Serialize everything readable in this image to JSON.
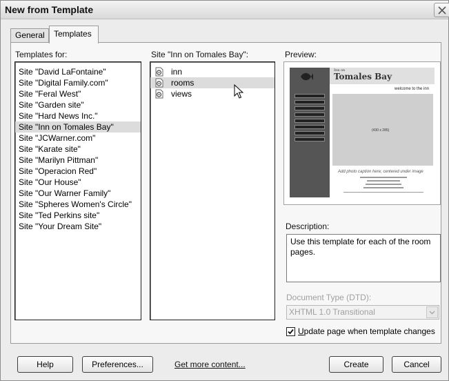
{
  "window": {
    "title": "New from Template"
  },
  "tabs": [
    {
      "label": "General"
    },
    {
      "label": "Templates"
    }
  ],
  "columns": {
    "templates_for_label": "Templates for:",
    "site_label": "Site \"Inn on Tomales Bay\":",
    "preview_label": "Preview:"
  },
  "sites": [
    "Site \"David LaFontaine\"",
    "Site \"Digital Family.com\"",
    "Site \"Feral West\"",
    "Site \"Garden site\"",
    "Site \"Hard News Inc.\"",
    "Site \"Inn on Tomales Bay\"",
    "Site \"JCWarner.com\"",
    "Site \"Karate site\"",
    "Site \"Marilyn Pittman\"",
    "Site \"Operacion Red\"",
    "Site \"Our House\"",
    "Site \"Our Warner Family\"",
    "Site \"Spheres Women's Circle\"",
    "Site \"Ted Perkins site\"",
    "Site \"Your Dream Site\""
  ],
  "selected_site": "Site \"Inn on Tomales Bay\"",
  "templates": [
    {
      "name": "inn",
      "icon": "template-file-icon"
    },
    {
      "name": "rooms",
      "icon": "template-file-icon"
    },
    {
      "name": "views",
      "icon": "template-file-icon"
    }
  ],
  "selected_template": "rooms",
  "preview": {
    "inn_small": "Inn on",
    "title": "Tomales Bay",
    "welcome": "welcome to the inn",
    "photo_label": "(430 x 285)",
    "caption": "Add photo caption here; centered under image"
  },
  "description": {
    "label": "Description:",
    "text": "Use this template for each of the room pages."
  },
  "doctype": {
    "label": "Document Type (DTD):",
    "value": "XHTML 1.0 Transitional"
  },
  "update_checkbox": {
    "checked": true,
    "label_first": "U",
    "label_rest": "pdate page when template changes"
  },
  "buttons": {
    "help": "Help",
    "preferences": "Preferences...",
    "get_more": "Get more content...",
    "create": "Create",
    "cancel": "Cancel"
  }
}
